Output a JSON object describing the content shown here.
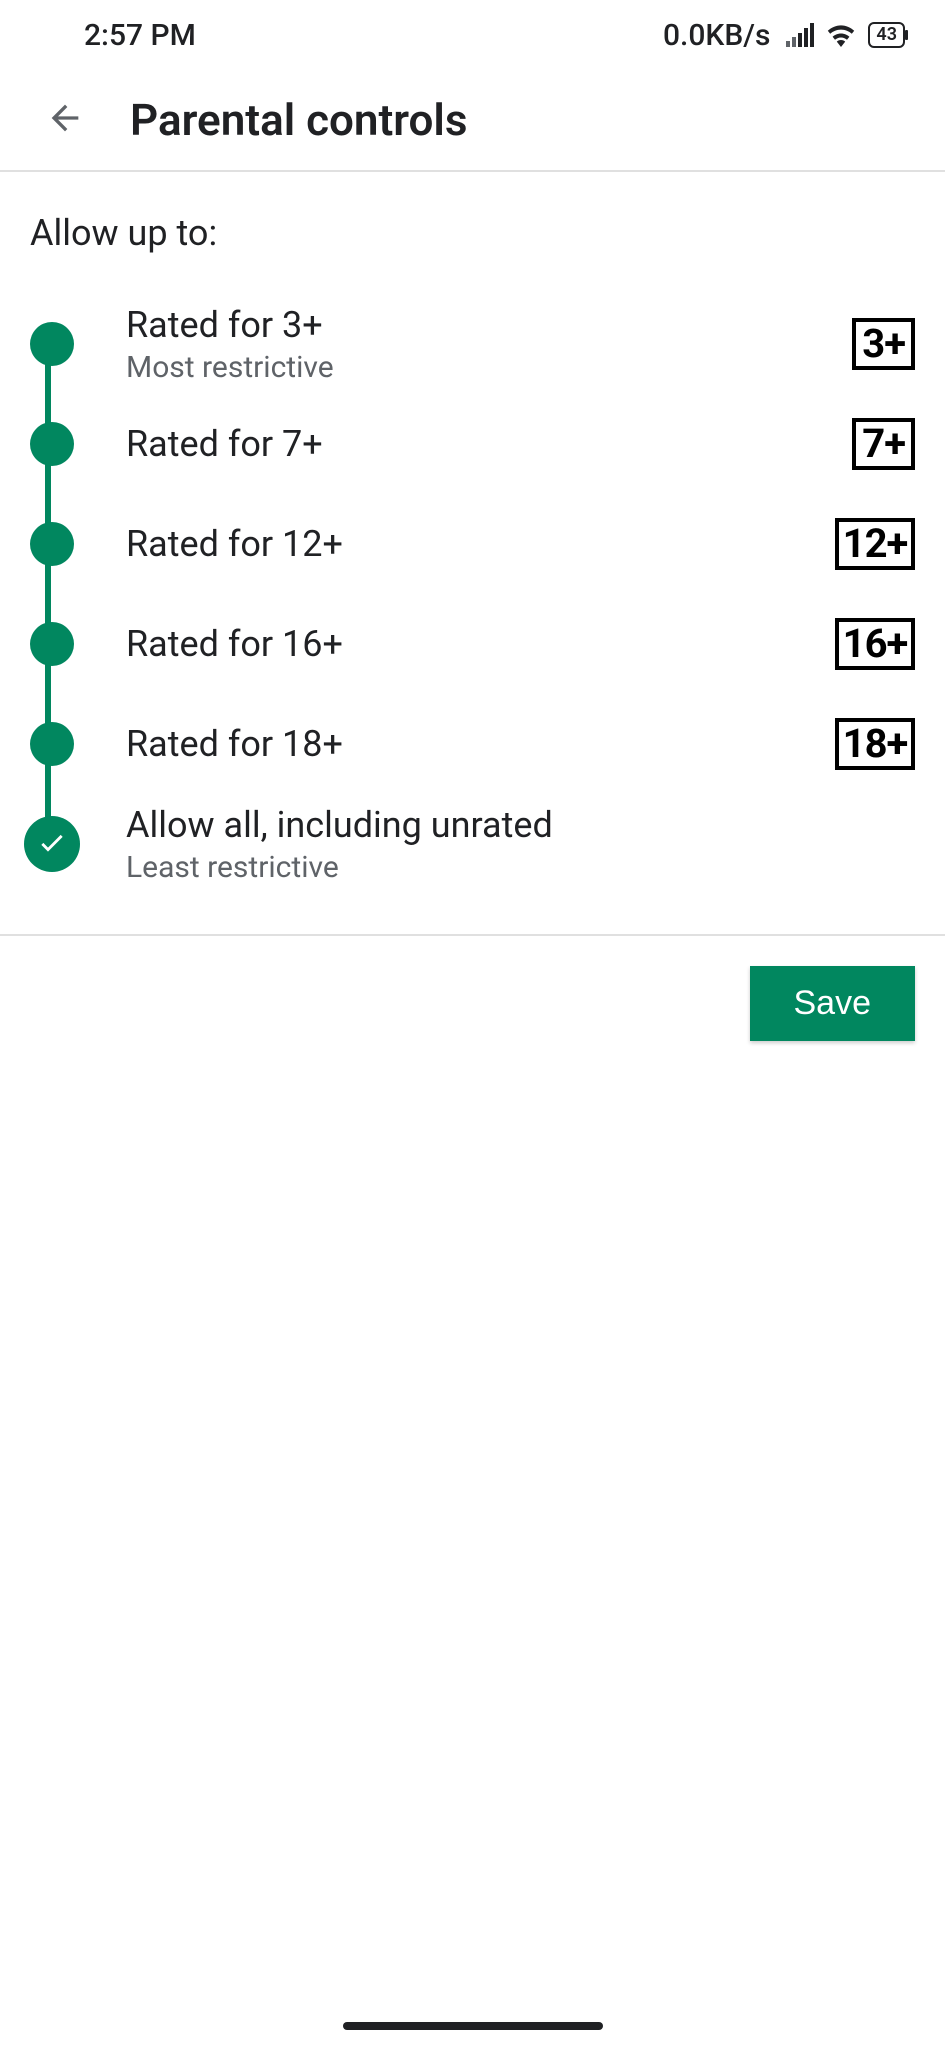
{
  "status_bar": {
    "time": "2:57 PM",
    "network_speed": "0.0KB/s",
    "battery_level": "43"
  },
  "header": {
    "title": "Parental controls"
  },
  "section_heading": "Allow up to:",
  "ratings": [
    {
      "title": "Rated for 3+",
      "subtitle": "Most restrictive",
      "badge": "3+",
      "selected": false
    },
    {
      "title": "Rated for 7+",
      "subtitle": "",
      "badge": "7+",
      "selected": false
    },
    {
      "title": "Rated for 12+",
      "subtitle": "",
      "badge": "12+",
      "selected": false
    },
    {
      "title": "Rated for 16+",
      "subtitle": "",
      "badge": "16+",
      "selected": false
    },
    {
      "title": "Rated for 18+",
      "subtitle": "",
      "badge": "18+",
      "selected": false
    },
    {
      "title": "Allow all, including unrated",
      "subtitle": "Least restrictive",
      "badge": "",
      "selected": true
    }
  ],
  "actions": {
    "save_label": "Save"
  },
  "colors": {
    "accent": "#01875f"
  }
}
